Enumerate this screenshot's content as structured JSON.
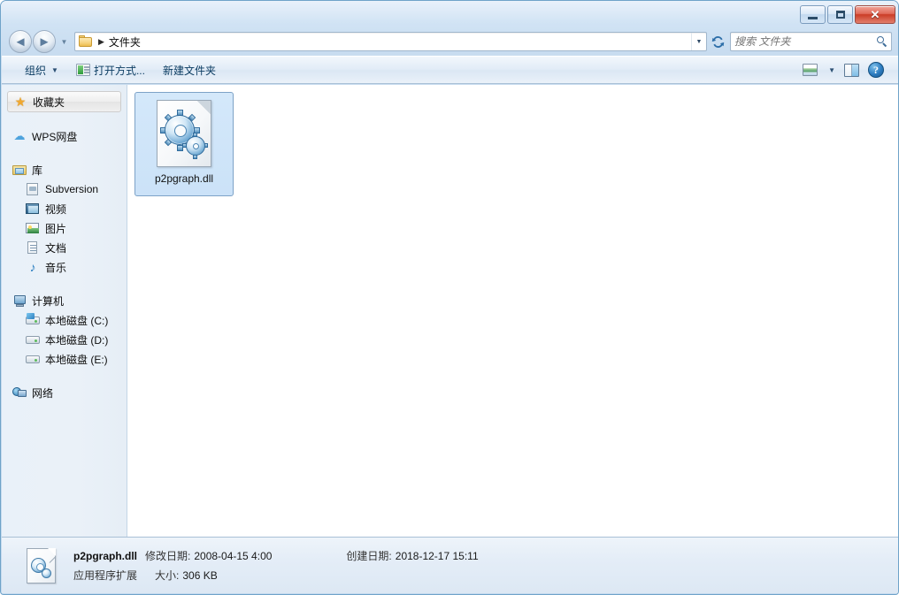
{
  "window": {
    "controls": {
      "minimize_label": "Minimize",
      "maximize_label": "Maximize",
      "close_label": "✕"
    }
  },
  "navigation": {
    "back_label": "◄",
    "forward_label": "►",
    "history_caret": "▼",
    "address": {
      "icon": "folder-icon",
      "separator": "▶",
      "crumb": "文件夹",
      "dropdown_caret": "▼"
    },
    "refresh_label": "⟳",
    "search": {
      "placeholder": "搜索 文件夹",
      "value": ""
    }
  },
  "toolbar": {
    "organize_label": "组织",
    "organize_caret": "▼",
    "open_with_label": "打开方式...",
    "new_folder_label": "新建文件夹",
    "view_caret": "▼",
    "help_label": "?"
  },
  "sidebar": {
    "groups": [
      {
        "header": {
          "label": "收藏夹",
          "icon": "star-icon",
          "selected": true
        }
      },
      {
        "header": {
          "label": "WPS网盘",
          "icon": "cloud-icon",
          "selected": false
        }
      },
      {
        "header": {
          "label": "库",
          "icon": "library-icon",
          "selected": false
        },
        "children": [
          {
            "label": "Subversion",
            "icon": "subversion-icon"
          },
          {
            "label": "视频",
            "icon": "video-icon"
          },
          {
            "label": "图片",
            "icon": "picture-icon"
          },
          {
            "label": "文档",
            "icon": "document-icon"
          },
          {
            "label": "音乐",
            "icon": "music-icon"
          }
        ]
      },
      {
        "header": {
          "label": "计算机",
          "icon": "computer-icon",
          "selected": false
        },
        "children": [
          {
            "label": "本地磁盘 (C:)",
            "icon": "drive-system-icon"
          },
          {
            "label": "本地磁盘 (D:)",
            "icon": "drive-icon"
          },
          {
            "label": "本地磁盘 (E:)",
            "icon": "drive-icon"
          }
        ]
      },
      {
        "header": {
          "label": "网络",
          "icon": "network-icon",
          "selected": false
        }
      }
    ]
  },
  "content": {
    "files": [
      {
        "name": "p2pgraph.dll",
        "icon": "dll-gear-icon",
        "selected": true
      }
    ]
  },
  "details": {
    "icon": "dll-gear-icon",
    "file_name": "p2pgraph.dll",
    "modified_label": "修改日期:",
    "modified_value": "2008-04-15 4:00",
    "created_label": "创建日期:",
    "created_value": "2018-12-17 15:11",
    "file_type": "应用程序扩展",
    "size_label": "大小:",
    "size_value": "306 KB"
  },
  "colors": {
    "accent": "#2c7fc0",
    "selection": "#cbe2f8",
    "close_button": "#cb3c26",
    "star": "#f0a830"
  }
}
